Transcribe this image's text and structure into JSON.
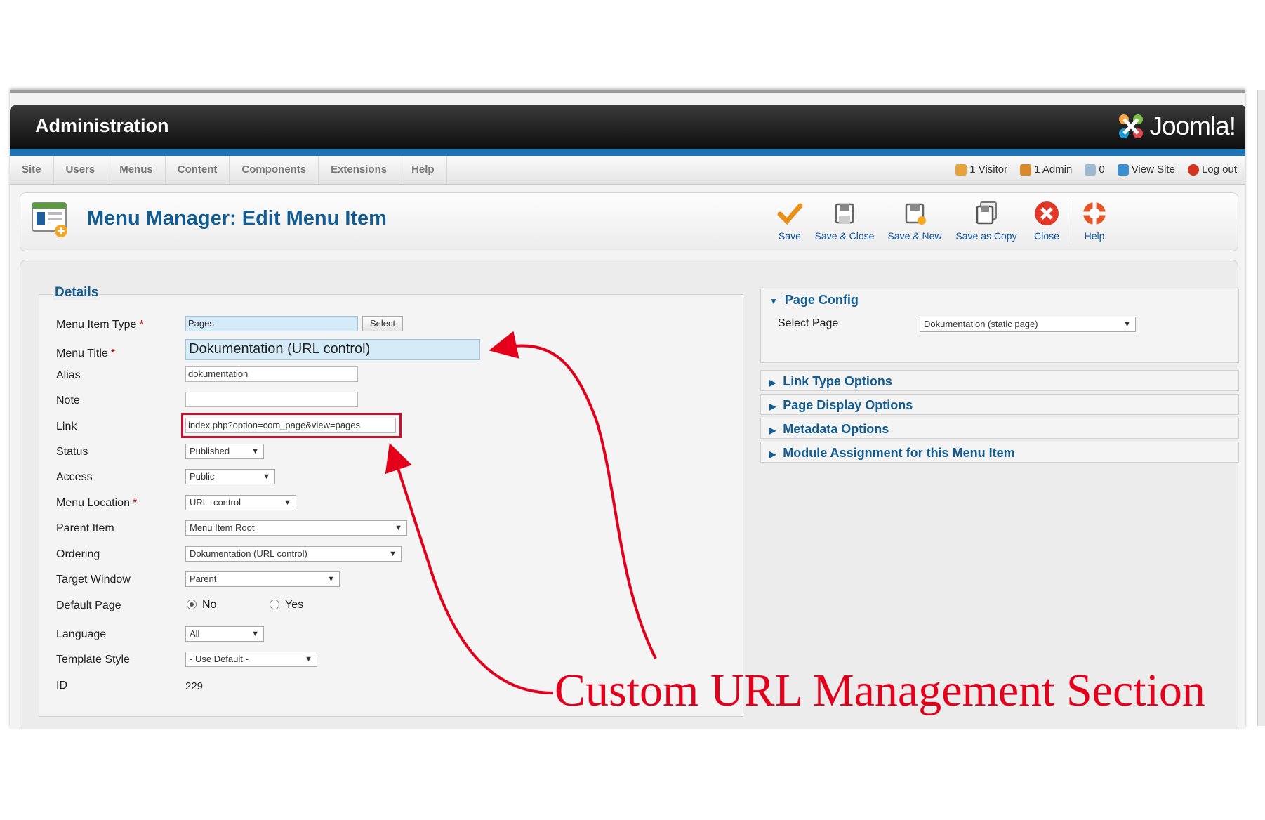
{
  "header": {
    "title": "Administration",
    "logo_text": "Joomla!"
  },
  "menubar": {
    "items": [
      "Site",
      "Users",
      "Menus",
      "Content",
      "Components",
      "Extensions",
      "Help"
    ]
  },
  "status": {
    "visitor": "1 Visitor",
    "admin": "1 Admin",
    "messages": "0",
    "view_site": "View Site",
    "logout": "Log out"
  },
  "toolbar": {
    "page_title": "Menu Manager: Edit Menu Item",
    "buttons": {
      "save": "Save",
      "save_close": "Save & Close",
      "save_new": "Save & New",
      "save_copy": "Save as Copy",
      "close": "Close",
      "help": "Help"
    }
  },
  "details": {
    "legend": "Details",
    "labels": {
      "menu_item_type": "Menu Item Type",
      "menu_title": "Menu Title",
      "alias": "Alias",
      "note": "Note",
      "link": "Link",
      "status": "Status",
      "access": "Access",
      "menu_location": "Menu Location",
      "parent_item": "Parent Item",
      "ordering": "Ordering",
      "target_window": "Target Window",
      "default_page": "Default Page",
      "language": "Language",
      "template_style": "Template Style",
      "id": "ID"
    },
    "required_mark": "*",
    "values": {
      "menu_item_type": "Pages",
      "select_button": "Select",
      "menu_title": "Dokumentation (URL control)",
      "alias": "dokumentation",
      "note": "",
      "link": "index.php?option=com_page&view=pages",
      "status": "Published",
      "access": "Public",
      "menu_location": "URL- control",
      "parent_item": "Menu Item Root",
      "ordering": "Dokumentation (URL control)",
      "target_window": "Parent",
      "default_page_no": "No",
      "default_page_yes": "Yes",
      "default_page_selected": "No",
      "language": "All",
      "template_style": "- Use Default -",
      "id": "229"
    }
  },
  "right_panels": {
    "page_config": {
      "title": "Page Config",
      "select_page_label": "Select Page",
      "select_page_value": "Dokumentation (static page)"
    },
    "collapsed": [
      "Link Type Options",
      "Page Display Options",
      "Metadata Options",
      "Module Assignment for this Menu Item"
    ]
  },
  "annotation": {
    "text": "Custom URL Management Section",
    "color": "#e4001b"
  },
  "colors": {
    "accent_blue": "#1d73b3",
    "title_blue": "#135c92",
    "link_blue": "#0b55a2",
    "highlight_red": "#c8102e"
  }
}
